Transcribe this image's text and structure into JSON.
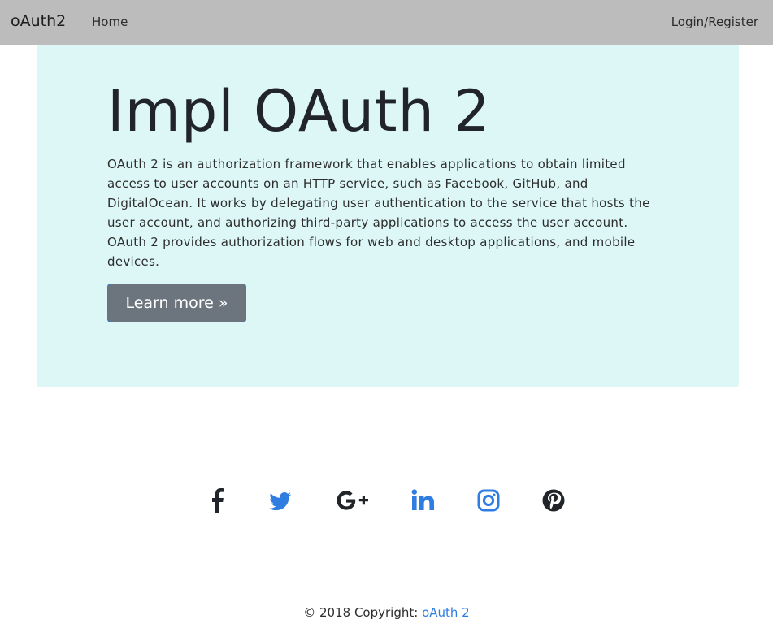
{
  "navbar": {
    "brand": "oAuth2",
    "home_label": "Home",
    "login_label": "Login/Register",
    "background": "#bcbcbc"
  },
  "jumbotron": {
    "title": "Impl OAuth 2",
    "text": "OAuth 2 is an authorization framework that enables applications to obtain limited access to user accounts on an HTTP service, such as Facebook, GitHub, and DigitalOcean. It works by delegating user authentication to the service that hosts the user account, and authorizing third-party applications to access the user account. OAuth 2 provides authorization flows for web and desktop applications, and mobile devices.",
    "button_label": "Learn more »",
    "background": "#ddf7f7"
  },
  "social_icons": [
    {
      "icon": "facebook-icon",
      "color": "#212529"
    },
    {
      "icon": "twitter-icon",
      "color": "#2f7de1"
    },
    {
      "icon": "google-plus-icon",
      "color": "#212529"
    },
    {
      "icon": "linkedin-icon",
      "color": "#2f7de1"
    },
    {
      "icon": "instagram-icon",
      "color": "#2f7de1"
    },
    {
      "icon": "pinterest-icon",
      "color": "#212529"
    }
  ],
  "footer": {
    "copyright_text": "© 2018 Copyright: ",
    "copyright_link": "oAuth 2",
    "link_color": "#2f7de1"
  }
}
